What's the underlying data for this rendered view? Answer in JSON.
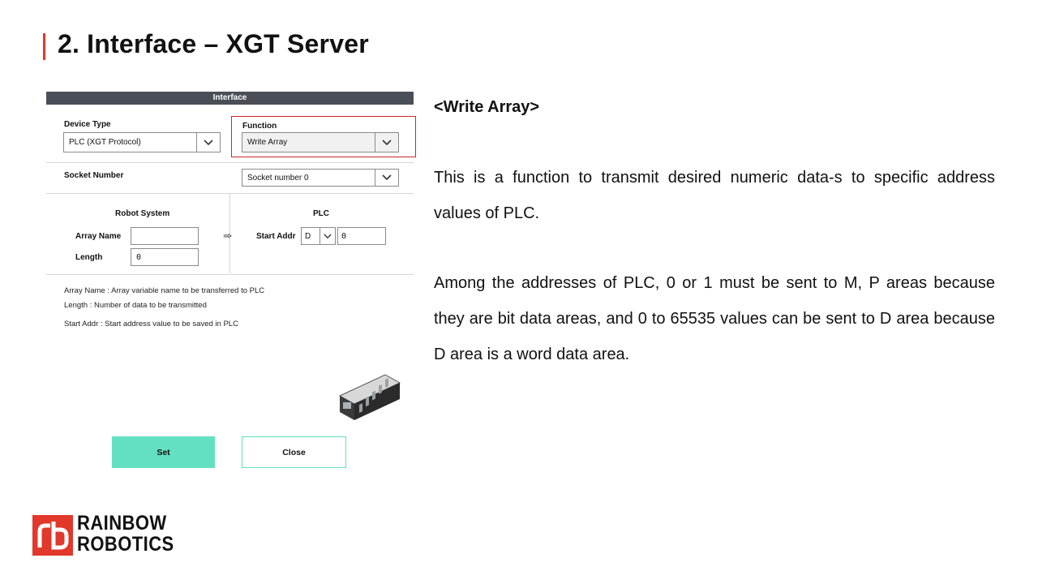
{
  "slide": {
    "title": "2. Interface – XGT Server"
  },
  "dialog": {
    "header": "Interface",
    "device_type": {
      "label": "Device Type",
      "value": "PLC (XGT Protocol)"
    },
    "function": {
      "label": "Function",
      "value": "Write Array"
    },
    "socket": {
      "label": "Socket Number",
      "value": "Socket number 0"
    },
    "robot_system": {
      "title": "Robot System",
      "array_name_label": "Array Name",
      "array_name_value": "",
      "length_label": "Length",
      "length_value": "0"
    },
    "arrow": "⇒",
    "plc": {
      "title": "PLC",
      "start_addr_label": "Start Addr",
      "area_value": "D",
      "addr_value": "0"
    },
    "notes": [
      "Array Name : Array variable name to be transferred to PLC",
      "Length : Number of data to be transmitted",
      "Start Addr : Start address value to be saved in PLC"
    ],
    "set_label": "Set",
    "close_label": "Close"
  },
  "content": {
    "subheading": "<Write Array>",
    "paragraph1": "This is a function to transmit desired numeric data-s to specific address values of PLC.",
    "paragraph2": "Among the addresses of PLC, 0 or 1 must be sent to M, P areas because they are bit data areas, and 0 to 65535 values can be sent to D area because D area is a word data area."
  },
  "logo": {
    "line1": "RAINBOW",
    "line2": "ROBOTICS"
  },
  "colors": {
    "accent_red": "#e2372b",
    "header_gray": "#4a4f57",
    "button_mint": "#63e0c0"
  }
}
